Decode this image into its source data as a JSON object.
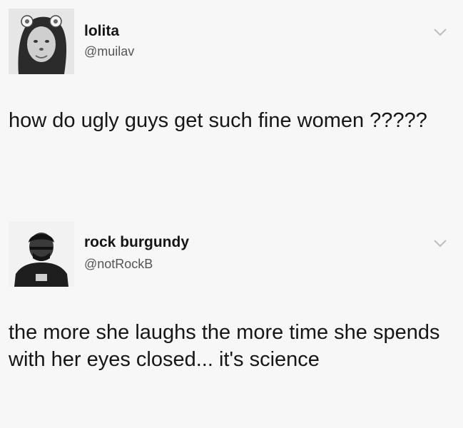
{
  "tweets": [
    {
      "display_name": "lolita",
      "handle": "@muilav",
      "text": "how do ugly guys get such fine women ?????",
      "avatar_icon": "avatar-photo-icon",
      "menu_icon": "chevron-down-icon"
    },
    {
      "display_name": "rock burgundy",
      "handle": "@notRockB",
      "text": "the more she laughs the more time she spends with her eyes closed... it's science",
      "avatar_icon": "avatar-photo-icon",
      "menu_icon": "chevron-down-icon"
    }
  ]
}
